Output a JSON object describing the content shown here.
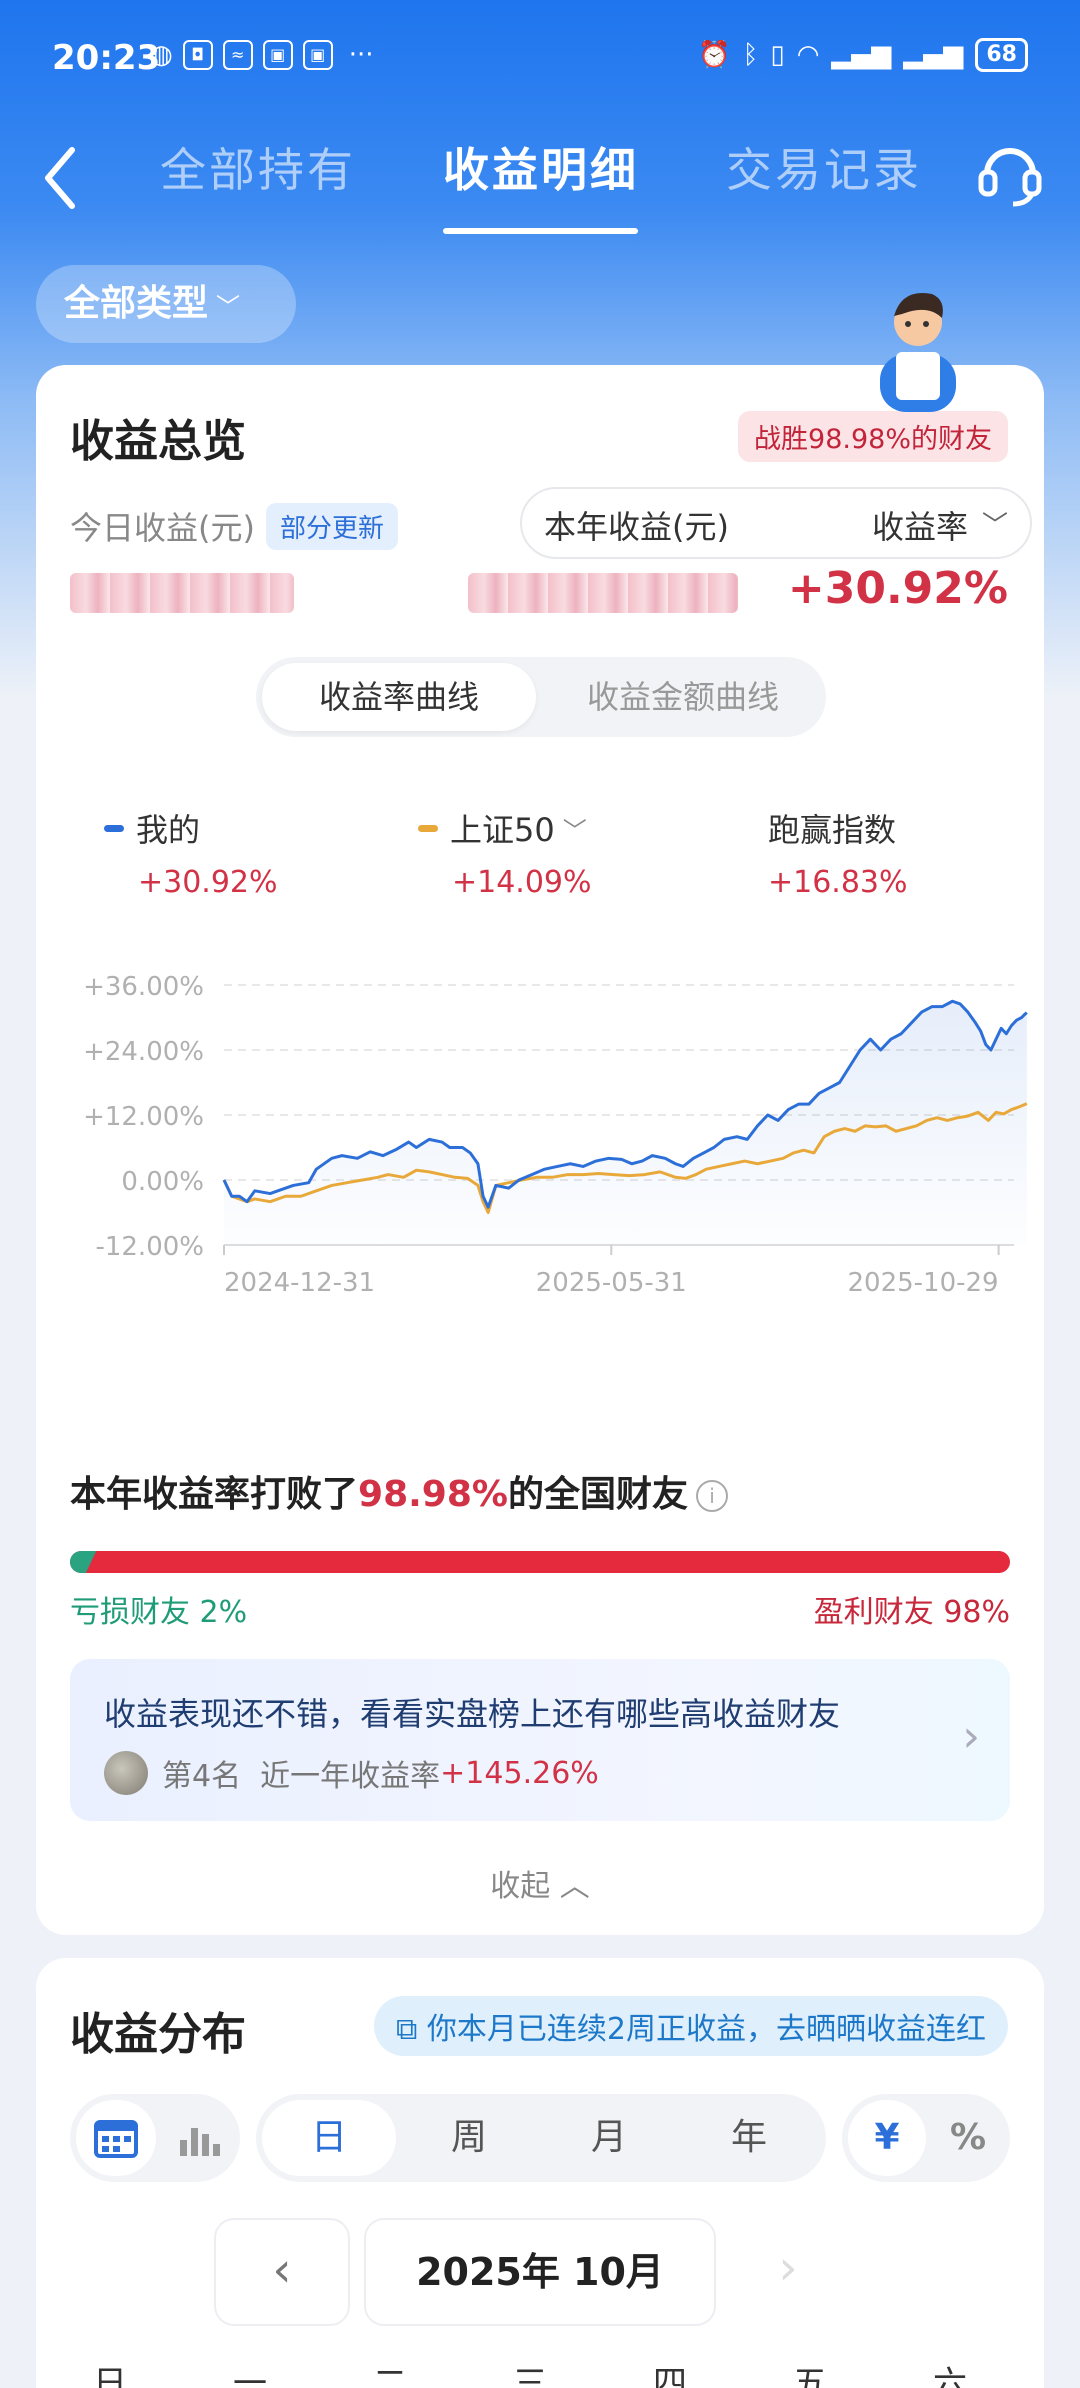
{
  "status": {
    "time": "20:23",
    "battery": "68"
  },
  "nav": {
    "tabs": [
      {
        "label": "全部持有"
      },
      {
        "label": "收益明细"
      },
      {
        "label": "交易记录"
      }
    ]
  },
  "filter": {
    "label": "全部类型"
  },
  "overview": {
    "title": "收益总览",
    "beat_badge": "战胜98.98%的财友",
    "today_label": "今日收益(元)",
    "partial_badge": "部分更新",
    "ytd_label": "本年收益(元)",
    "rate_label": "收益率",
    "rate_value": "+30.92%"
  },
  "curve_tabs": {
    "rate": "收益率曲线",
    "amount": "收益金额曲线"
  },
  "legend": [
    {
      "name": "我的",
      "value": "+30.92%",
      "color": "#2d6fd8"
    },
    {
      "name": "上证50",
      "value": "+14.09%",
      "color": "#e8a93a"
    },
    {
      "name": "跑赢指数",
      "value": "+16.83%"
    }
  ],
  "chart_data": {
    "type": "line",
    "y_ticks": [
      "+36.00%",
      "+24.00%",
      "+12.00%",
      "0.00%",
      "-12.00%"
    ],
    "ylim": [
      -12,
      36
    ],
    "x_ticks": [
      "2024-12-31",
      "2025-05-31",
      "2025-10-29"
    ],
    "xlim": [
      "2024-12-31",
      "2025-11-04"
    ],
    "series": [
      {
        "name": "我的",
        "color": "#2d6fd8",
        "values": [
          [
            0,
            0
          ],
          [
            3,
            -3
          ],
          [
            6,
            -3
          ],
          [
            9,
            -4
          ],
          [
            12,
            -2
          ],
          [
            18,
            -2.5
          ],
          [
            21,
            -2
          ],
          [
            27,
            -1
          ],
          [
            33,
            -0.5
          ],
          [
            36,
            2
          ],
          [
            42,
            4
          ],
          [
            46,
            4.5
          ],
          [
            52,
            4
          ],
          [
            57,
            5.2
          ],
          [
            62,
            4.5
          ],
          [
            67,
            5.6
          ],
          [
            72,
            7
          ],
          [
            75,
            6
          ],
          [
            80,
            7.5
          ],
          [
            85,
            7
          ],
          [
            88,
            6
          ],
          [
            93,
            6
          ],
          [
            96,
            5
          ],
          [
            99,
            3
          ],
          [
            101,
            -3
          ],
          [
            103,
            -5
          ],
          [
            106,
            -1
          ],
          [
            111,
            -1.5
          ],
          [
            115,
            0
          ],
          [
            120,
            1
          ],
          [
            125,
            2
          ],
          [
            130,
            2.5
          ],
          [
            135,
            3
          ],
          [
            140,
            2.5
          ],
          [
            145,
            3.5
          ],
          [
            150,
            4
          ],
          [
            155,
            3.8
          ],
          [
            159,
            3
          ],
          [
            163,
            3.5
          ],
          [
            167,
            4.5
          ],
          [
            172,
            4
          ],
          [
            176,
            3
          ],
          [
            179,
            2.5
          ],
          [
            183,
            4
          ],
          [
            187,
            5
          ],
          [
            191,
            6
          ],
          [
            195,
            7.5
          ],
          [
            200,
            8
          ],
          [
            204,
            7.5
          ],
          [
            208,
            10
          ],
          [
            212,
            12
          ],
          [
            216,
            11
          ],
          [
            220,
            13
          ],
          [
            224,
            14
          ],
          [
            228,
            14
          ],
          [
            232,
            16
          ],
          [
            236,
            17
          ],
          [
            240,
            18
          ],
          [
            244,
            21
          ],
          [
            248,
            24
          ],
          [
            252,
            26
          ],
          [
            256,
            24
          ],
          [
            260,
            26
          ],
          [
            264,
            27
          ],
          [
            268,
            29
          ],
          [
            272,
            31
          ],
          [
            276,
            32
          ],
          [
            280,
            32
          ],
          [
            284,
            33
          ],
          [
            287,
            32.5
          ],
          [
            290,
            31
          ],
          [
            293,
            29
          ],
          [
            295,
            27.5
          ],
          [
            297,
            25
          ],
          [
            299,
            24
          ],
          [
            301,
            26
          ],
          [
            303,
            28
          ],
          [
            305,
            27
          ],
          [
            307,
            28.5
          ],
          [
            309,
            29.5
          ],
          [
            311,
            30
          ],
          [
            312,
            30.5
          ],
          [
            313,
            30.9
          ]
        ]
      },
      {
        "name": "上证50",
        "color": "#e8a93a",
        "values": [
          [
            0,
            0
          ],
          [
            3,
            -3
          ],
          [
            6,
            -3.5
          ],
          [
            9,
            -4
          ],
          [
            12,
            -3.5
          ],
          [
            18,
            -4
          ],
          [
            24,
            -3
          ],
          [
            30,
            -3
          ],
          [
            36,
            -2
          ],
          [
            42,
            -1
          ],
          [
            48,
            -0.5
          ],
          [
            54,
            0
          ],
          [
            60,
            0.5
          ],
          [
            64,
            1
          ],
          [
            70,
            0.5
          ],
          [
            75,
            1.8
          ],
          [
            80,
            1.5
          ],
          [
            85,
            1
          ],
          [
            90,
            0.5
          ],
          [
            95,
            0.3
          ],
          [
            99,
            -1
          ],
          [
            101,
            -4
          ],
          [
            103,
            -6
          ],
          [
            106,
            -1
          ],
          [
            111,
            -0.5
          ],
          [
            116,
            0
          ],
          [
            122,
            0.5
          ],
          [
            128,
            0.5
          ],
          [
            134,
            1
          ],
          [
            140,
            1
          ],
          [
            146,
            1.2
          ],
          [
            152,
            1
          ],
          [
            158,
            0.8
          ],
          [
            164,
            1
          ],
          [
            170,
            1.5
          ],
          [
            176,
            0.5
          ],
          [
            180,
            0.3
          ],
          [
            184,
            1
          ],
          [
            188,
            2
          ],
          [
            193,
            2.5
          ],
          [
            198,
            3
          ],
          [
            203,
            3.5
          ],
          [
            208,
            3
          ],
          [
            213,
            3.5
          ],
          [
            218,
            4
          ],
          [
            222,
            5
          ],
          [
            226,
            5.5
          ],
          [
            230,
            5
          ],
          [
            234,
            8
          ],
          [
            238,
            9
          ],
          [
            242,
            9.5
          ],
          [
            246,
            9
          ],
          [
            250,
            10
          ],
          [
            254,
            9.8
          ],
          [
            258,
            10
          ],
          [
            262,
            9
          ],
          [
            266,
            9.5
          ],
          [
            270,
            10
          ],
          [
            274,
            11
          ],
          [
            278,
            11.5
          ],
          [
            282,
            11
          ],
          [
            286,
            11.5
          ],
          [
            290,
            11.8
          ],
          [
            294,
            12.5
          ],
          [
            298,
            11
          ],
          [
            301,
            12.5
          ],
          [
            304,
            12.2
          ],
          [
            307,
            13
          ],
          [
            310,
            13.5
          ],
          [
            313,
            14.1
          ]
        ]
      }
    ]
  },
  "beat": {
    "prefix": "本年收益率打败了",
    "pct": "98.98%",
    "suffix": "的全国财友",
    "loss_pct": 2,
    "loss": "亏损财友 2%",
    "profit": "盈利财友 98%"
  },
  "promo": {
    "title": "收益表现还不错，看看实盘榜上还有哪些高收益财友",
    "rank": "第4名",
    "desc": "近一年收益率",
    "rate": "+145.26%"
  },
  "collapse": "收起",
  "dist": {
    "title": "收益分布",
    "streak": "你本月已连续2周正收益，去晒晒收益连红",
    "periods": [
      "日",
      "周",
      "月",
      "年"
    ],
    "currency": "¥",
    "percent": "%",
    "month": "2025年 10月",
    "weekdays": [
      "日",
      "一",
      "二",
      "三",
      "四",
      "五",
      "六"
    ]
  }
}
